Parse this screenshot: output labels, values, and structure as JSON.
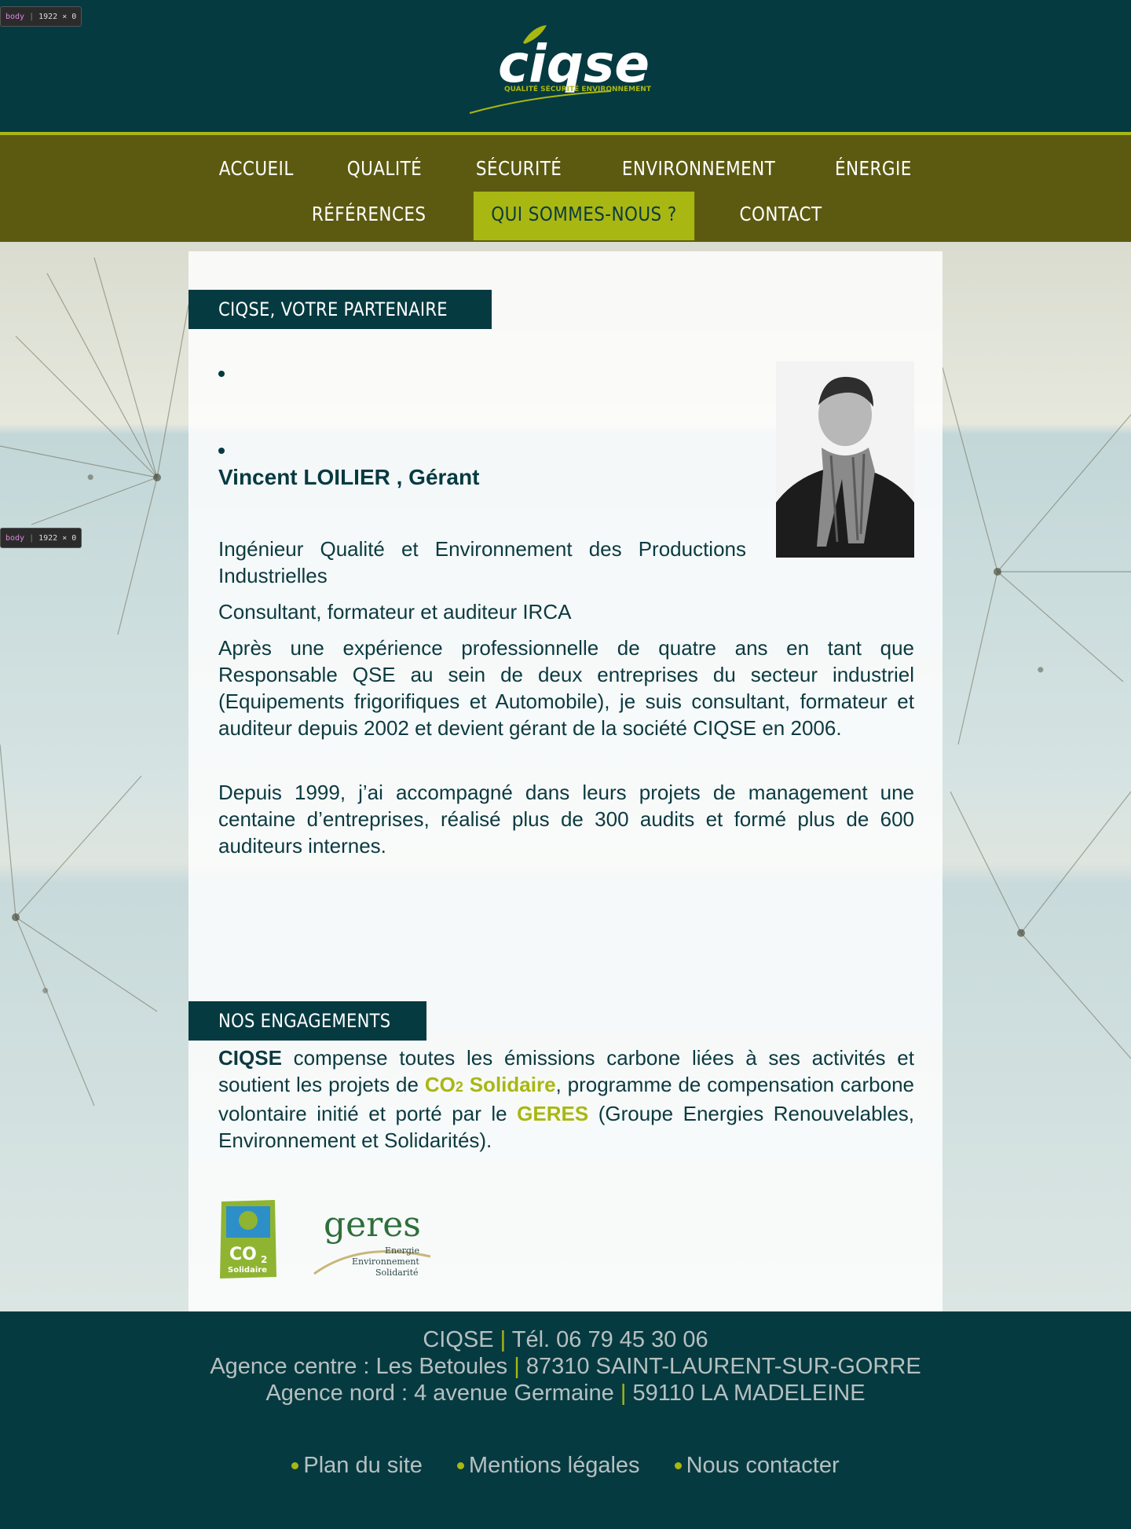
{
  "devtools": {
    "tag": "body",
    "size": "1922 × 0"
  },
  "logo": {
    "brand": "ciqse",
    "tagline": "QUALITÉ SÉCURITÉ ENVIRONNEMENT"
  },
  "nav": {
    "row1": [
      "ACCUEIL",
      "QUALITÉ",
      "SÉCURITÉ",
      "ENVIRONNEMENT",
      "ÉNERGIE"
    ],
    "row2": [
      "RÉFÉRENCES",
      "QUI SOMMES-NOUS ?",
      "CONTACT"
    ],
    "active": "QUI SOMMES-NOUS ?"
  },
  "partner": {
    "title": "CIQSE, VOTRE PARTENAIRE",
    "name": "Vincent LOILIER , Gérant",
    "p1": "Ingénieur Qualité et Environnement des Productions Industrielles",
    "p2": "Consultant, formateur et auditeur IRCA",
    "p3": "Après une expérience professionnelle de quatre ans en tant que Responsable QSE au sein de deux entreprises du secteur industriel (Equipements frigorifiques et Automobile), je suis consultant, formateur et auditeur depuis 2002 et devient gérant de la société CIQSE en 2006.",
    "p4": "Depuis 1999, j’ai accompagné dans leurs projets de management une centaine d’entreprises, réalisé plus de 300 audits et formé plus de 600 auditeurs internes."
  },
  "engagements": {
    "title": "NOS ENGAGEMENTS",
    "brand": "CIQSE",
    "t1": " compense toutes les émissions carbone liées à ses activités et soutient les projets de ",
    "co2": "CO",
    "co2sub": "2",
    "solidaire": " Solidaire",
    "t2": ", programme de compensation carbone volontaire initié et porté par le ",
    "geres": "GERES",
    "t3": " (Groupe Energies Renouvelables, Environnement et Solidarités).",
    "badge_co2": {
      "main": "CO",
      "sub": "2",
      "label": "Solidaire"
    },
    "badge_geres": {
      "word": "geres",
      "l1": "Energie",
      "l2": "Environnement",
      "l3": "Solidarité"
    }
  },
  "footer": {
    "company": "CIQSE",
    "phone": "Tél. 06 79 45 30 06",
    "agency1": "Agence centre : Les Betoules",
    "agency1_city": "87310 SAINT-LAURENT-SUR-GORRE",
    "agency2": "Agence nord : 4 avenue Germaine",
    "agency2_city": "59110 LA MADELEINE",
    "pipe": "|",
    "links": [
      "Plan du site",
      "Mentions légales",
      "Nous contacter"
    ]
  },
  "colors": {
    "dark_teal": "#063a41",
    "olive": "#5c5a10",
    "accent_green": "#a9b712"
  }
}
